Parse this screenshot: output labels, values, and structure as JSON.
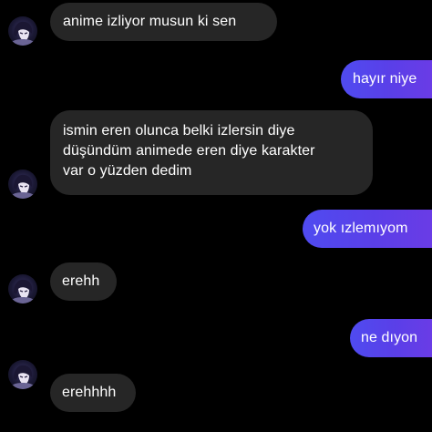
{
  "conversation": {
    "messages": [
      {
        "direction": "incoming",
        "lines": [
          "anime izliyor musun ki sen"
        ]
      },
      {
        "direction": "outgoing",
        "lines": [
          "hayır niye"
        ]
      },
      {
        "direction": "incoming",
        "lines": [
          "ismin eren olunca belki izlersin diye",
          "düşündüm animede eren diye karakter",
          "var o yüzden dedim"
        ]
      },
      {
        "direction": "outgoing",
        "lines": [
          "yok ızlemıyom"
        ]
      },
      {
        "direction": "incoming",
        "lines": [
          "erehh"
        ]
      },
      {
        "direction": "outgoing",
        "lines": [
          "ne dıyon"
        ]
      },
      {
        "direction": "incoming",
        "lines": [
          "erehhhh"
        ]
      }
    ]
  },
  "colors": {
    "background": "#000000",
    "incoming_bubble": "#262626",
    "outgoing_bubble": "#5a45ec",
    "text": "#ffffff"
  },
  "icons": {
    "avatar": "anime-character-avatar-icon"
  }
}
